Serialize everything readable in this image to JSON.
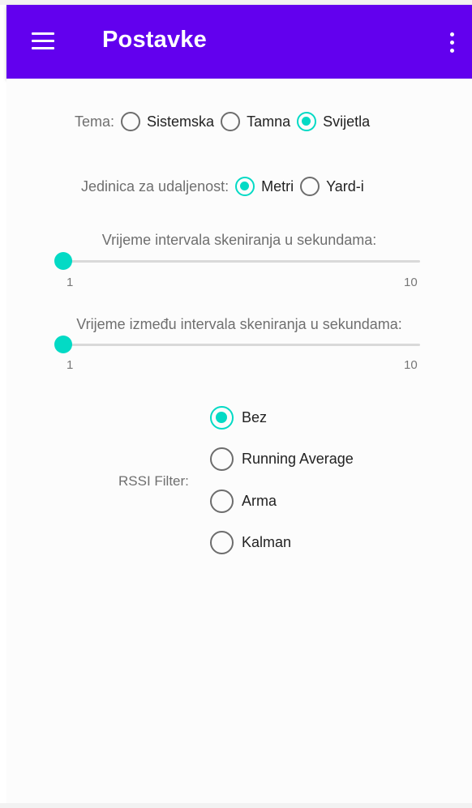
{
  "appbar": {
    "title": "Postavke",
    "menu_icon": "hamburger-menu-icon",
    "overflow_icon": "more-vertical-icon",
    "color": "#6200ee"
  },
  "accent_color": "#03dac5",
  "theme": {
    "label": "Tema:",
    "options": [
      {
        "label": "Sistemska",
        "selected": false
      },
      {
        "label": "Tamna",
        "selected": false
      },
      {
        "label": "Svijetla",
        "selected": true
      }
    ]
  },
  "distance_unit": {
    "label": "Jedinica za udaljenost:",
    "options": [
      {
        "label": "Metri",
        "selected": true
      },
      {
        "label": "Yard-i",
        "selected": false
      }
    ]
  },
  "scan_interval": {
    "title": "Vrijeme intervala skeniranja u sekundama:",
    "min": "1",
    "max": "10",
    "value": 1
  },
  "scan_gap": {
    "title": "Vrijeme između intervala skeniranja u sekundama:",
    "min": "1",
    "max": "10",
    "value": 1
  },
  "rssi_filter": {
    "label": "RSSI Filter:",
    "options": [
      {
        "label": "Bez",
        "selected": true
      },
      {
        "label": "Running Average",
        "selected": false
      },
      {
        "label": "Arma",
        "selected": false
      },
      {
        "label": "Kalman",
        "selected": false
      }
    ]
  }
}
